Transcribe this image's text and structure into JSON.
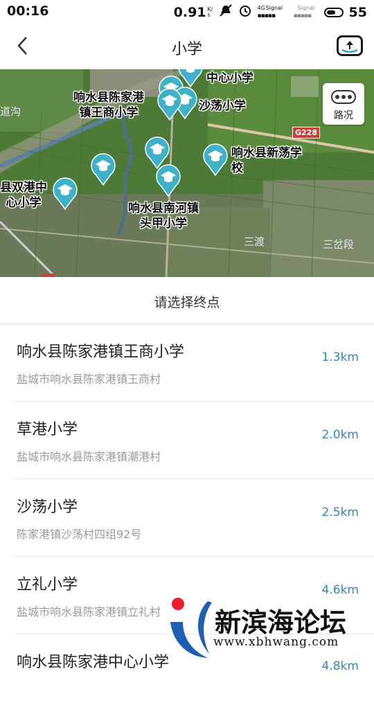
{
  "status_bar": {
    "time": "00:16",
    "net_speed": "0.91",
    "net_unit": "K/s",
    "signal_4g": "4G",
    "signal_label": "Signal",
    "signal_label2": "Signal",
    "battery": "55"
  },
  "header": {
    "title": "小学"
  },
  "map": {
    "traffic_label": "路况",
    "road_badge": "G228",
    "places": [
      "道沟",
      "三渡",
      "三岔段"
    ],
    "pin_labels": [
      "中心小学",
      "响水县陈家港\n镇王商小学",
      "沙荡小学",
      "响水县新荡学\n校",
      "县双港中\n心小学",
      "响水县南河镇\n头甲小学"
    ]
  },
  "prompt": "请选择终点",
  "results": [
    {
      "name": "响水县陈家港镇王商小学",
      "address": "盐城市响水县陈家港镇王商村",
      "distance": "1.3km"
    },
    {
      "name": "草港小学",
      "address": "盐城市响水县陈家港镇潮港村",
      "distance": "2.0km"
    },
    {
      "name": "沙荡小学",
      "address": "陈家港镇沙荡村四组92号",
      "distance": "2.5km"
    },
    {
      "name": "立礼小学",
      "address": "盐城市响水县陈家港镇立礼村",
      "distance": "4.6km"
    },
    {
      "name": "响水县陈家港中心小学",
      "address": "",
      "distance": "4.8km"
    }
  ],
  "watermark": {
    "text": "新滨海论坛",
    "url": "www.xbhwang.com"
  },
  "colors": {
    "accent_blue": "#2f86c6",
    "pin_teal": "#3fb2c9"
  }
}
